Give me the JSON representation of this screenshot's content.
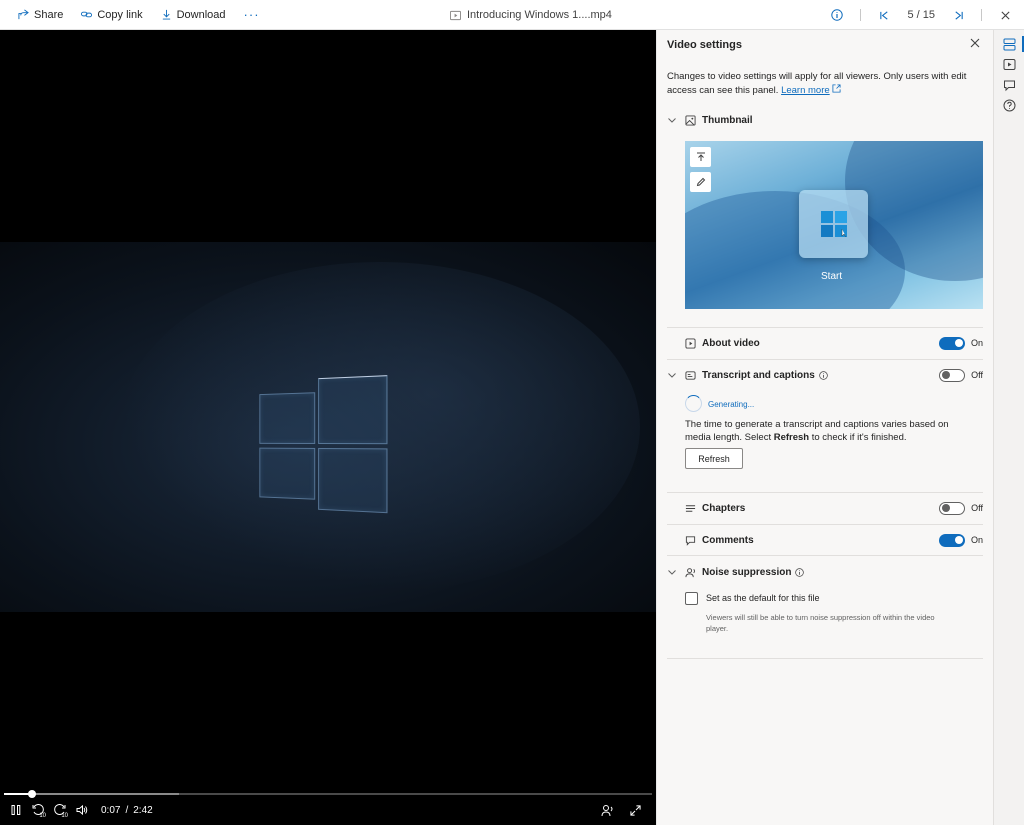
{
  "toolbar": {
    "share_label": "Share",
    "copy_link_label": "Copy link",
    "download_label": "Download",
    "more_label": "···",
    "file_name": "Introducing Windows 1....mp4",
    "pager": "5 / 15"
  },
  "player": {
    "current_time": "0:07",
    "time_sep": "/",
    "duration": "2:42",
    "progress_fraction": 0.043,
    "skip_seconds": "10"
  },
  "settings": {
    "title": "Video settings",
    "description": "Changes to video settings will apply for all viewers. Only users with edit access can see this panel.",
    "learn_more": "Learn more",
    "thumbnail": {
      "label": "Thumbnail",
      "preview_text": "Start"
    },
    "about_video": {
      "label": "About video",
      "state": "On"
    },
    "transcript": {
      "label": "Transcript and captions",
      "state": "Off",
      "generating": "Generating...",
      "desc_before": "The time to generate a transcript and captions varies based on media length. Select ",
      "desc_bold": "Refresh",
      "desc_after": " to check if it's finished.",
      "refresh_label": "Refresh"
    },
    "chapters": {
      "label": "Chapters",
      "state": "Off"
    },
    "comments": {
      "label": "Comments",
      "state": "On"
    },
    "noise": {
      "label": "Noise suppression",
      "checkbox_label": "Set as the default for this file",
      "checkbox_sub": "Viewers will still be able to turn noise suppression off within the video player."
    }
  },
  "colors": {
    "accent": "#0f6cbd",
    "panel_bg": "#f8f7f6"
  }
}
